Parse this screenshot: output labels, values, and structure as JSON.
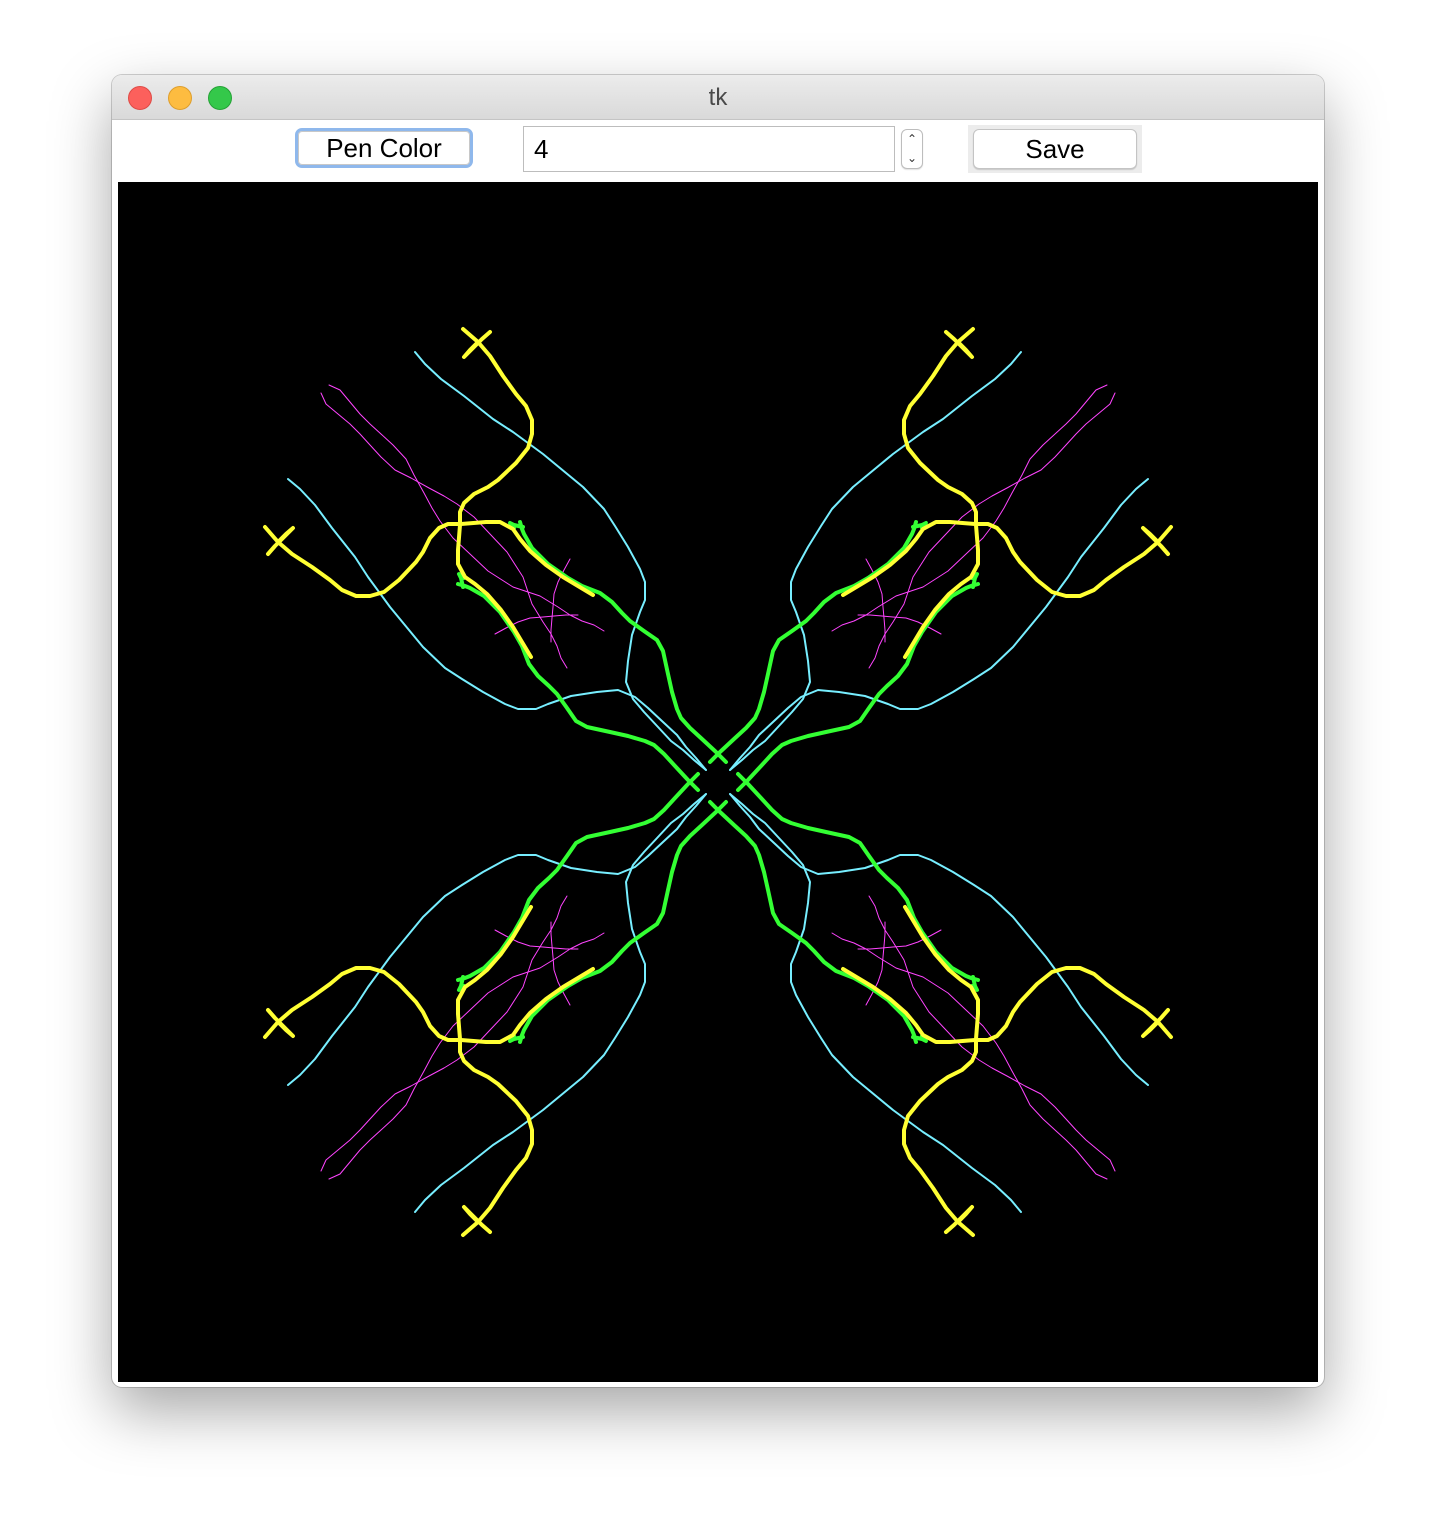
{
  "window": {
    "title": "tk"
  },
  "toolbar": {
    "pen_color_label": "Pen Color",
    "size_value": "4",
    "spin_up_glyph": "⌃",
    "spin_down_glyph": "⌄",
    "save_label": "Save"
  },
  "canvas": {
    "background": "#000000",
    "symmetry_fold": 8,
    "strokes": [
      {
        "name": "yellow-stroke",
        "color": "#ffff33",
        "width": 4
      },
      {
        "name": "green-stroke",
        "color": "#33ff33",
        "width": 4
      },
      {
        "name": "magenta-stroke",
        "color": "#ff44ff",
        "width": 1
      },
      {
        "name": "cyan-stroke",
        "color": "#77eeff",
        "width": 2
      }
    ]
  }
}
